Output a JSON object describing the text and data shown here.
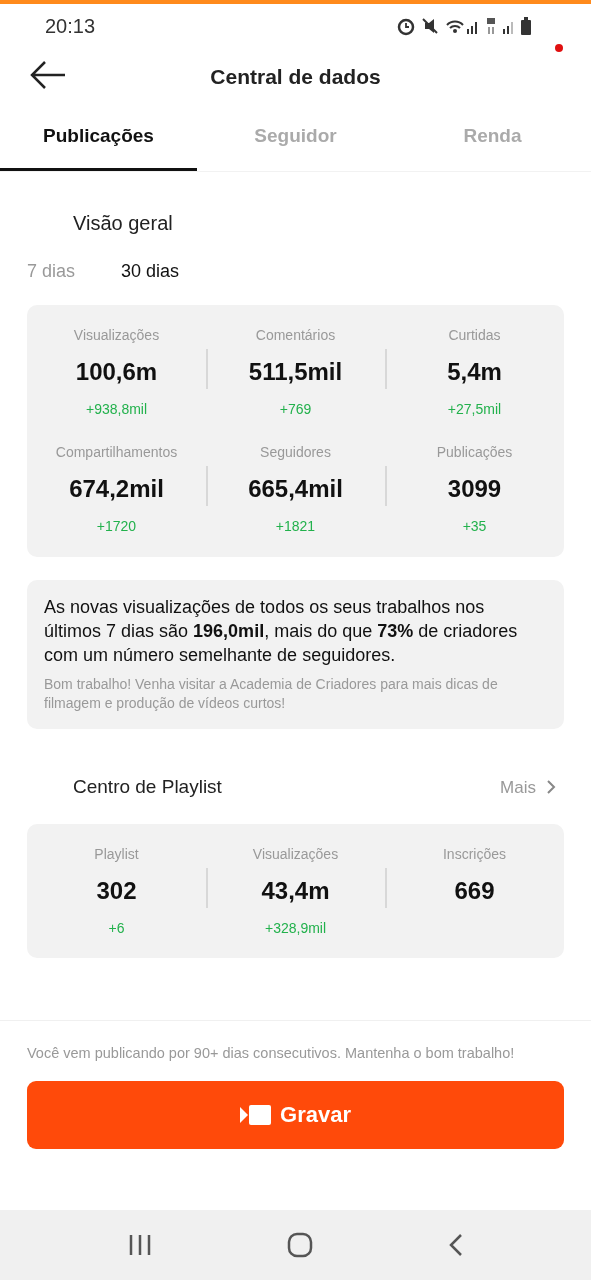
{
  "status_bar": {
    "time": "20:13"
  },
  "header": {
    "title": "Central de dados",
    "notification_dot": true
  },
  "tabs": [
    {
      "label": "Publicações",
      "selected": true
    },
    {
      "label": "Seguidor",
      "selected": false
    },
    {
      "label": "Renda",
      "selected": false
    }
  ],
  "overview": {
    "title": "Visão geral",
    "periods": [
      {
        "label": "7 dias",
        "selected": false
      },
      {
        "label": "30 dias",
        "selected": true
      }
    ],
    "stats": [
      {
        "label": "Visualizações",
        "value": "100,6m",
        "delta": "+938,8mil"
      },
      {
        "label": "Comentários",
        "value": "511,5mil",
        "delta": "+769"
      },
      {
        "label": "Curtidas",
        "value": "5,4m",
        "delta": "+27,5mil"
      },
      {
        "label": "Compartilhamentos",
        "value": "674,2mil",
        "delta": "+1720"
      },
      {
        "label": "Seguidores",
        "value": "665,4mil",
        "delta": "+1821"
      },
      {
        "label": "Publicações",
        "value": "3099",
        "delta": "+35"
      }
    ]
  },
  "insight": {
    "text": "As novas visualizações de todos os seus trabalhos nos últimos 7 dias são **196,0mil**, mais do que **73%** de criadores com um número semelhante de seguidores.",
    "tip": "Bom trabalho! Venha visitar a Academia de Criadores para mais dicas de filmagem e produção de vídeos curtos!"
  },
  "playlist": {
    "title": "Centro de Playlist",
    "more": "Mais",
    "stats": [
      {
        "label": "Playlist",
        "value": "302",
        "delta": "+6"
      },
      {
        "label": "Visualizações",
        "value": "43,4m",
        "delta": "+328,9mil"
      },
      {
        "label": "Inscrições",
        "value": "669"
      }
    ]
  },
  "footer": {
    "note": "Você vem publicando por 90+ dias consecutivos. Mantenha o bom trabalho!",
    "button": "Gravar"
  }
}
